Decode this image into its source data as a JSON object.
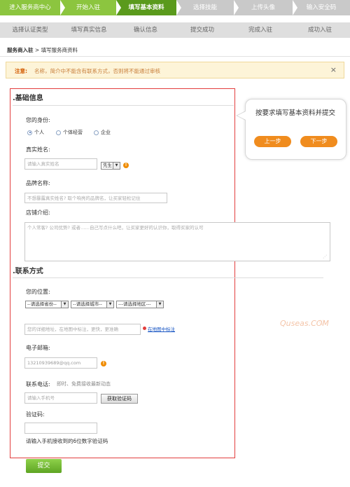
{
  "steps_row1": [
    {
      "label": "进入服务商中心",
      "state": "done"
    },
    {
      "label": "开始入驻",
      "state": "done"
    },
    {
      "label": "填写基本资料",
      "state": "active"
    },
    {
      "label": "选择技能",
      "state": "todo"
    },
    {
      "label": "上传头像",
      "state": "todo"
    },
    {
      "label": "输入安全码",
      "state": "todo"
    }
  ],
  "steps_row2": [
    {
      "label": "选择认证类型"
    },
    {
      "label": "填写真实信息"
    },
    {
      "label": "确认信息"
    },
    {
      "label": "提交成功"
    },
    {
      "label": "完成入驻"
    },
    {
      "label": "成功入驻"
    }
  ],
  "breadcrumb": {
    "root": "服务商入驻",
    "sep": " > ",
    "current": "填写服务商资料"
  },
  "notice": {
    "label": "注意:",
    "text": "名称，简介中不能含有联系方式，否则将不能通过审核",
    "close": "×"
  },
  "basic": {
    "title": ".基础信息",
    "identity_label": "您的身份:",
    "identity_options": [
      "个人",
      "个体经营",
      "企业"
    ],
    "identity_selected": "个人",
    "realname_label": "真实姓名:",
    "realname_placeholder": "请输入真实姓名",
    "gender_value": "先生",
    "brand_label": "品牌名称:",
    "brand_placeholder": "不想暴露真实姓名? 取个响亮的品牌名，让买家轻松记住",
    "intro_label": "店铺介绍:",
    "intro_placeholder": "个人常客? 公司优势? 或者……自己写点什么吧，让买家更好的认识你，取得买家的认可"
  },
  "contact": {
    "title": ".联系方式",
    "location_label": "您的位置:",
    "province": "--请选择省份--",
    "city": "--请选择城市--",
    "district": "---请选择地区---",
    "address_placeholder": "您的详细地址，在地图中标注，更快，更准确",
    "map_link": "在地图中标注",
    "email_label": "电子邮箱:",
    "email_value": "13210939689@qq.com",
    "phone_label": "联系电话:",
    "phone_hint": "即时、免费接收最新动态",
    "phone_placeholder": "请输入手机号",
    "get_code_button": "获取验证码",
    "code_label": "验证码:",
    "code_hint": "请输入手机接收到的6位数字验证码"
  },
  "submit_label": "提交",
  "tip": {
    "text": "按要求填写基本资料并提交",
    "prev": "上一步",
    "next": "下一步"
  },
  "watermark": "Quseas.COM"
}
